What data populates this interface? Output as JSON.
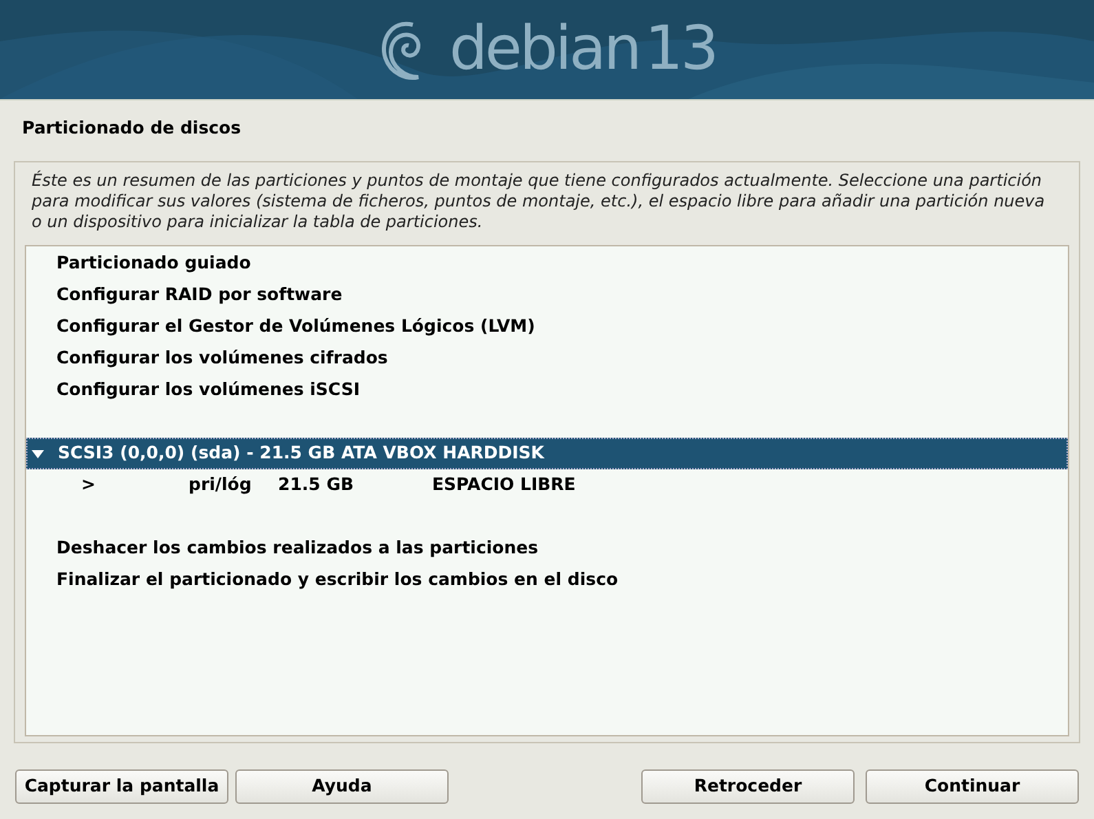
{
  "banner": {
    "logo_text": "debian",
    "version": "13"
  },
  "title": "Particionado de discos",
  "description": "Éste es un resumen de las particiones y puntos de montaje que tiene configurados actualmente. Seleccione una partición para modificar sus valores (sistema de ficheros, puntos de montaje, etc.), el espacio libre para añadir una partición nueva o un dispositivo para inicializar la tabla de particiones.",
  "groups": [
    [
      {
        "kind": "action",
        "label": "Particionado guiado",
        "selected": false
      },
      {
        "kind": "action",
        "label": "Configurar RAID por software",
        "selected": false
      },
      {
        "kind": "action",
        "label": "Configurar el Gestor de Volúmenes Lógicos (LVM)",
        "selected": false
      },
      {
        "kind": "action",
        "label": "Configurar los volúmenes cifrados",
        "selected": false
      },
      {
        "kind": "action",
        "label": "Configurar los volúmenes iSCSI",
        "selected": false
      }
    ],
    [
      {
        "kind": "disk",
        "label": "SCSI3 (0,0,0) (sda) - 21.5 GB ATA VBOX HARDDISK",
        "selected": true,
        "expanded": true
      },
      {
        "kind": "partition",
        "marker": ">",
        "type": "pri/lóg",
        "size": "21.5 GB",
        "description": "ESPACIO LIBRE",
        "selected": false
      }
    ],
    [
      {
        "kind": "action",
        "label": "Deshacer los cambios realizados a las particiones",
        "selected": false
      },
      {
        "kind": "action",
        "label": "Finalizar el particionado y escribir los cambios en el disco",
        "selected": false
      }
    ]
  ],
  "buttons_left": [
    "Capturar la pantalla",
    "Ayuda"
  ],
  "buttons_right": [
    "Retroceder",
    "Continuar"
  ]
}
